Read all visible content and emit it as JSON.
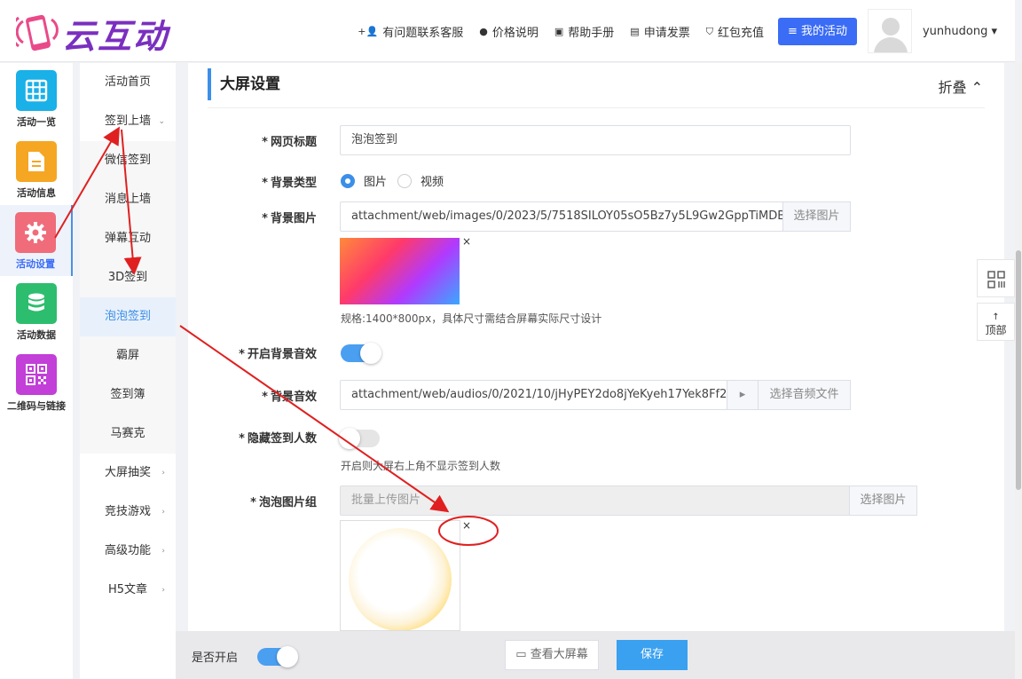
{
  "header": {
    "logo_text": "云互动",
    "nav": [
      {
        "icon": "user-plus-icon",
        "glyph": "+👤",
        "label": "有问题联系客服"
      },
      {
        "icon": "coin-icon",
        "glyph": "●",
        "label": "价格说明"
      },
      {
        "icon": "book-icon",
        "glyph": "▣",
        "label": "帮助手册"
      },
      {
        "icon": "printer-icon",
        "glyph": "▤",
        "label": "申请发票"
      },
      {
        "icon": "shield-icon",
        "glyph": "⛉",
        "label": "红包充值"
      }
    ],
    "my_activity": "≡ 我的活动",
    "username": "yunhudong ▾"
  },
  "iconbar": [
    {
      "label": "活动一览",
      "color": "#1ab0e8",
      "glyph": "▦",
      "active": false
    },
    {
      "label": "活动信息",
      "color": "#f5a623",
      "glyph": "▤",
      "active": false
    },
    {
      "label": "活动设置",
      "color": "#f06c7a",
      "glyph": "⚙",
      "active": true
    },
    {
      "label": "活动数据",
      "color": "#2dbd6e",
      "glyph": "≋",
      "active": false
    },
    {
      "label": "二维码与链接",
      "color": "#c23fd8",
      "glyph": "▩",
      "active": false
    }
  ],
  "submenu": [
    {
      "label": "活动首页",
      "arrow": ""
    },
    {
      "label": "签到上墙",
      "arrow": "⌄"
    },
    {
      "label": "微信签到",
      "arrow": "",
      "sub": true
    },
    {
      "label": "消息上墙",
      "arrow": "",
      "sub": true
    },
    {
      "label": "弹幕互动",
      "arrow": "",
      "sub": true
    },
    {
      "label": "3D签到",
      "arrow": "",
      "sub": true
    },
    {
      "label": "泡泡签到",
      "arrow": "",
      "sub": true,
      "active": true
    },
    {
      "label": "霸屏",
      "arrow": "",
      "sub": true
    },
    {
      "label": "签到簿",
      "arrow": "",
      "sub": true
    },
    {
      "label": "马赛克",
      "arrow": "",
      "sub": true
    },
    {
      "label": "大屏抽奖",
      "arrow": "›"
    },
    {
      "label": "竞技游戏",
      "arrow": "›"
    },
    {
      "label": "高级功能",
      "arrow": "›"
    },
    {
      "label": "H5文章",
      "arrow": "›"
    }
  ],
  "section": {
    "title": "大屏设置",
    "collapse": "折叠 ⌃"
  },
  "form": {
    "page_title_label": "网页标题",
    "page_title_value": "泡泡签到",
    "bg_type_label": "背景类型",
    "bg_type_options": [
      "图片",
      "视频"
    ],
    "bg_image_label": "背景图片",
    "bg_image_value": "attachment/web/images/0/2023/5/7518SILOY05sO5Bz7y5L9Gw2GppTiMDB.svg",
    "select_image": "选择图片",
    "bg_hint": "规格:1400*800px，具体尺寸需结合屏幕实际尺寸设计",
    "bg_music_toggle_label": "开启背景音效",
    "bg_music_label": "背景音效",
    "bg_music_value": "attachment/web/audios/0/2021/10/jHyPEY2do8jYeKyeh17Yek8Ff2oKeOhK.mp3",
    "play_glyph": "▸",
    "select_audio": "选择音频文件",
    "hide_count_label": "隐藏签到人数",
    "hide_count_hint": "开启则大屏右上角不显示签到人数",
    "bubble_group_label": "泡泡图片组",
    "bubble_placeholder": "批量上传图片",
    "close_glyph": "×"
  },
  "float": {
    "qr_glyph": "▣",
    "top_arrow": "↑",
    "top_label": "顶部"
  },
  "bottom": {
    "enable_label": "是否开启",
    "view_screen": "▭ 查看大屏幕",
    "save": "保存"
  },
  "colors": {
    "accent": "#3b8fe8",
    "primary_button": "#3b6cf6",
    "annotation": "#e02020"
  }
}
